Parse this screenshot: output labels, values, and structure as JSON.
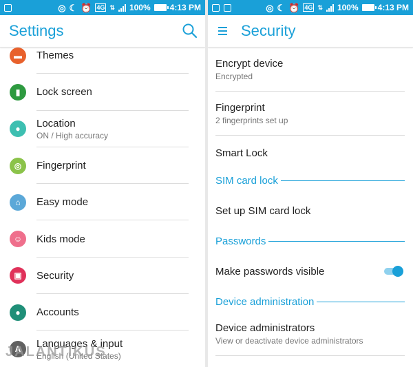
{
  "status_left": {
    "time": "4:13 PM",
    "battery": "100%",
    "network": "4G",
    "icons": [
      "usb-icon",
      "nfc-icon",
      "moon-icon",
      "alarm-icon",
      "data-arrows-icon",
      "signal-icon",
      "battery-icon"
    ]
  },
  "status_right": {
    "time": "4:13 PM",
    "battery": "100%",
    "network": "4G",
    "icons": [
      "usb-icon",
      "image-icon",
      "nfc-icon",
      "moon-icon",
      "alarm-icon",
      "data-arrows-icon",
      "signal-icon",
      "battery-icon"
    ]
  },
  "settings": {
    "title": "Settings",
    "items": [
      {
        "label": "Themes",
        "icon": "paint-roller-icon",
        "color": "#e8612c"
      },
      {
        "label": "Lock screen",
        "icon": "lock-screen-icon",
        "color": "#2e9a40"
      },
      {
        "label": "Location",
        "subtitle": "ON / High accuracy",
        "icon": "location-pin-icon",
        "color": "#3dbfb1"
      },
      {
        "label": "Fingerprint",
        "icon": "fingerprint-icon",
        "color": "#8bc34a"
      },
      {
        "label": "Easy mode",
        "icon": "easy-mode-icon",
        "color": "#5ba8d8"
      },
      {
        "label": "Kids mode",
        "icon": "kids-face-icon",
        "color": "#ef6f8c"
      },
      {
        "label": "Security",
        "icon": "padlock-icon",
        "color": "#e0315a"
      },
      {
        "label": "Accounts",
        "icon": "account-icon",
        "color": "#1f8f78"
      },
      {
        "label": "Languages & input",
        "subtitle": "English (United States)",
        "icon": "language-icon",
        "color": "#616161"
      }
    ]
  },
  "security": {
    "title": "Security",
    "items": [
      {
        "kind": "item",
        "label": "Encrypt device",
        "subtitle": "Encrypted"
      },
      {
        "kind": "item",
        "label": "Fingerprint",
        "subtitle": "2 fingerprints set up"
      },
      {
        "kind": "item",
        "label": "Smart Lock"
      },
      {
        "kind": "section",
        "label": "SIM card lock"
      },
      {
        "kind": "item",
        "label": "Set up SIM card lock"
      },
      {
        "kind": "section",
        "label": "Passwords"
      },
      {
        "kind": "item",
        "label": "Make passwords visible",
        "toggle": true
      },
      {
        "kind": "section",
        "label": "Device administration"
      },
      {
        "kind": "item",
        "label": "Device administrators",
        "subtitle": "View or deactivate device administrators"
      }
    ]
  },
  "watermark": "JALANTIKUS",
  "accent": "#1aa0d8"
}
